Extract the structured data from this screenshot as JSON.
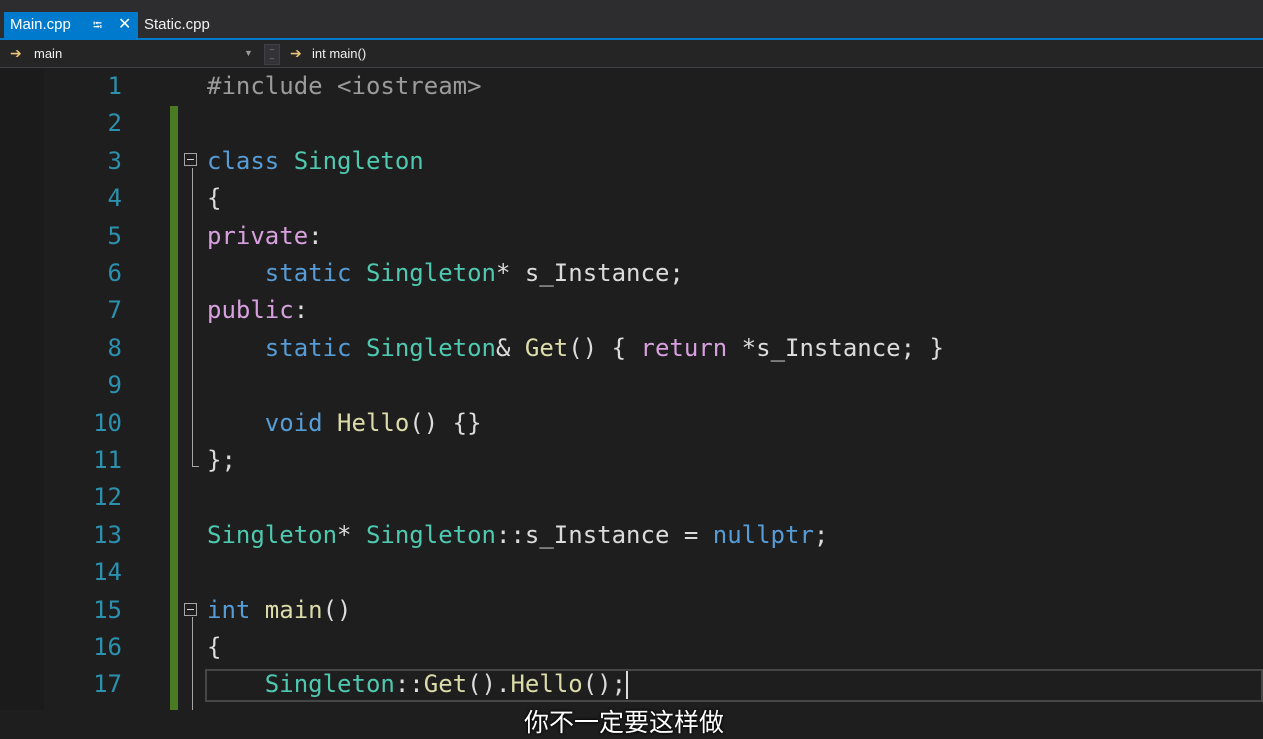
{
  "tabs": [
    {
      "label": "Main.cpp",
      "active": true,
      "pin_icon": "pin-icon",
      "close_icon": "close-icon"
    },
    {
      "label": "Static.cpp",
      "active": false
    }
  ],
  "navbar": {
    "scope": "main",
    "member": "int main()"
  },
  "editor": {
    "line_numbers": [
      "1",
      "2",
      "3",
      "4",
      "5",
      "6",
      "7",
      "8",
      "9",
      "10",
      "11",
      "12",
      "13",
      "14",
      "15",
      "16",
      "17"
    ],
    "lines": [
      [
        {
          "t": "#include <iostream>",
          "c": "pp"
        }
      ],
      [],
      [
        {
          "t": "class ",
          "c": "ty"
        },
        {
          "t": "Singleton",
          "c": "cl"
        }
      ],
      [
        {
          "t": "{",
          "c": "pl"
        }
      ],
      [
        {
          "t": "private",
          "c": "kw"
        },
        {
          "t": ":",
          "c": "pl"
        }
      ],
      [
        {
          "t": "    static ",
          "c": "ty"
        },
        {
          "t": "Singleton",
          "c": "cl"
        },
        {
          "t": "* s_Instance;",
          "c": "pl"
        }
      ],
      [
        {
          "t": "public",
          "c": "kw"
        },
        {
          "t": ":",
          "c": "pl"
        }
      ],
      [
        {
          "t": "    static ",
          "c": "ty"
        },
        {
          "t": "Singleton",
          "c": "cl"
        },
        {
          "t": "& ",
          "c": "pl"
        },
        {
          "t": "Get",
          "c": "fn"
        },
        {
          "t": "() { ",
          "c": "pl"
        },
        {
          "t": "return",
          "c": "kw"
        },
        {
          "t": " *s_Instance; }",
          "c": "pl"
        }
      ],
      [],
      [
        {
          "t": "    void ",
          "c": "ty"
        },
        {
          "t": "Hello",
          "c": "fn"
        },
        {
          "t": "() {}",
          "c": "pl"
        }
      ],
      [
        {
          "t": "};",
          "c": "pl"
        }
      ],
      [],
      [
        {
          "t": "Singleton",
          "c": "cl"
        },
        {
          "t": "* ",
          "c": "pl"
        },
        {
          "t": "Singleton",
          "c": "cl"
        },
        {
          "t": "::s_Instance = ",
          "c": "pl"
        },
        {
          "t": "nullptr",
          "c": "ty"
        },
        {
          "t": ";",
          "c": "pl"
        }
      ],
      [],
      [
        {
          "t": "int ",
          "c": "ty"
        },
        {
          "t": "main",
          "c": "fn"
        },
        {
          "t": "()",
          "c": "pl"
        }
      ],
      [
        {
          "t": "{",
          "c": "pl"
        }
      ],
      [
        {
          "t": "    ",
          "c": "pl"
        },
        {
          "t": "Singleton",
          "c": "cl"
        },
        {
          "t": "::",
          "c": "pl"
        },
        {
          "t": "Get",
          "c": "fn"
        },
        {
          "t": "().",
          "c": "pl"
        },
        {
          "t": "Hello",
          "c": "fn"
        },
        {
          "t": "();",
          "c": "pl"
        }
      ]
    ]
  },
  "subtitle": "你不一定要这样做",
  "colors": {
    "accent": "#007acc",
    "line_number": "#2b91af",
    "keyword": "#d8a0df",
    "type": "#569cd6",
    "class": "#4ec9b0",
    "change_bar": "#4a7a23"
  }
}
